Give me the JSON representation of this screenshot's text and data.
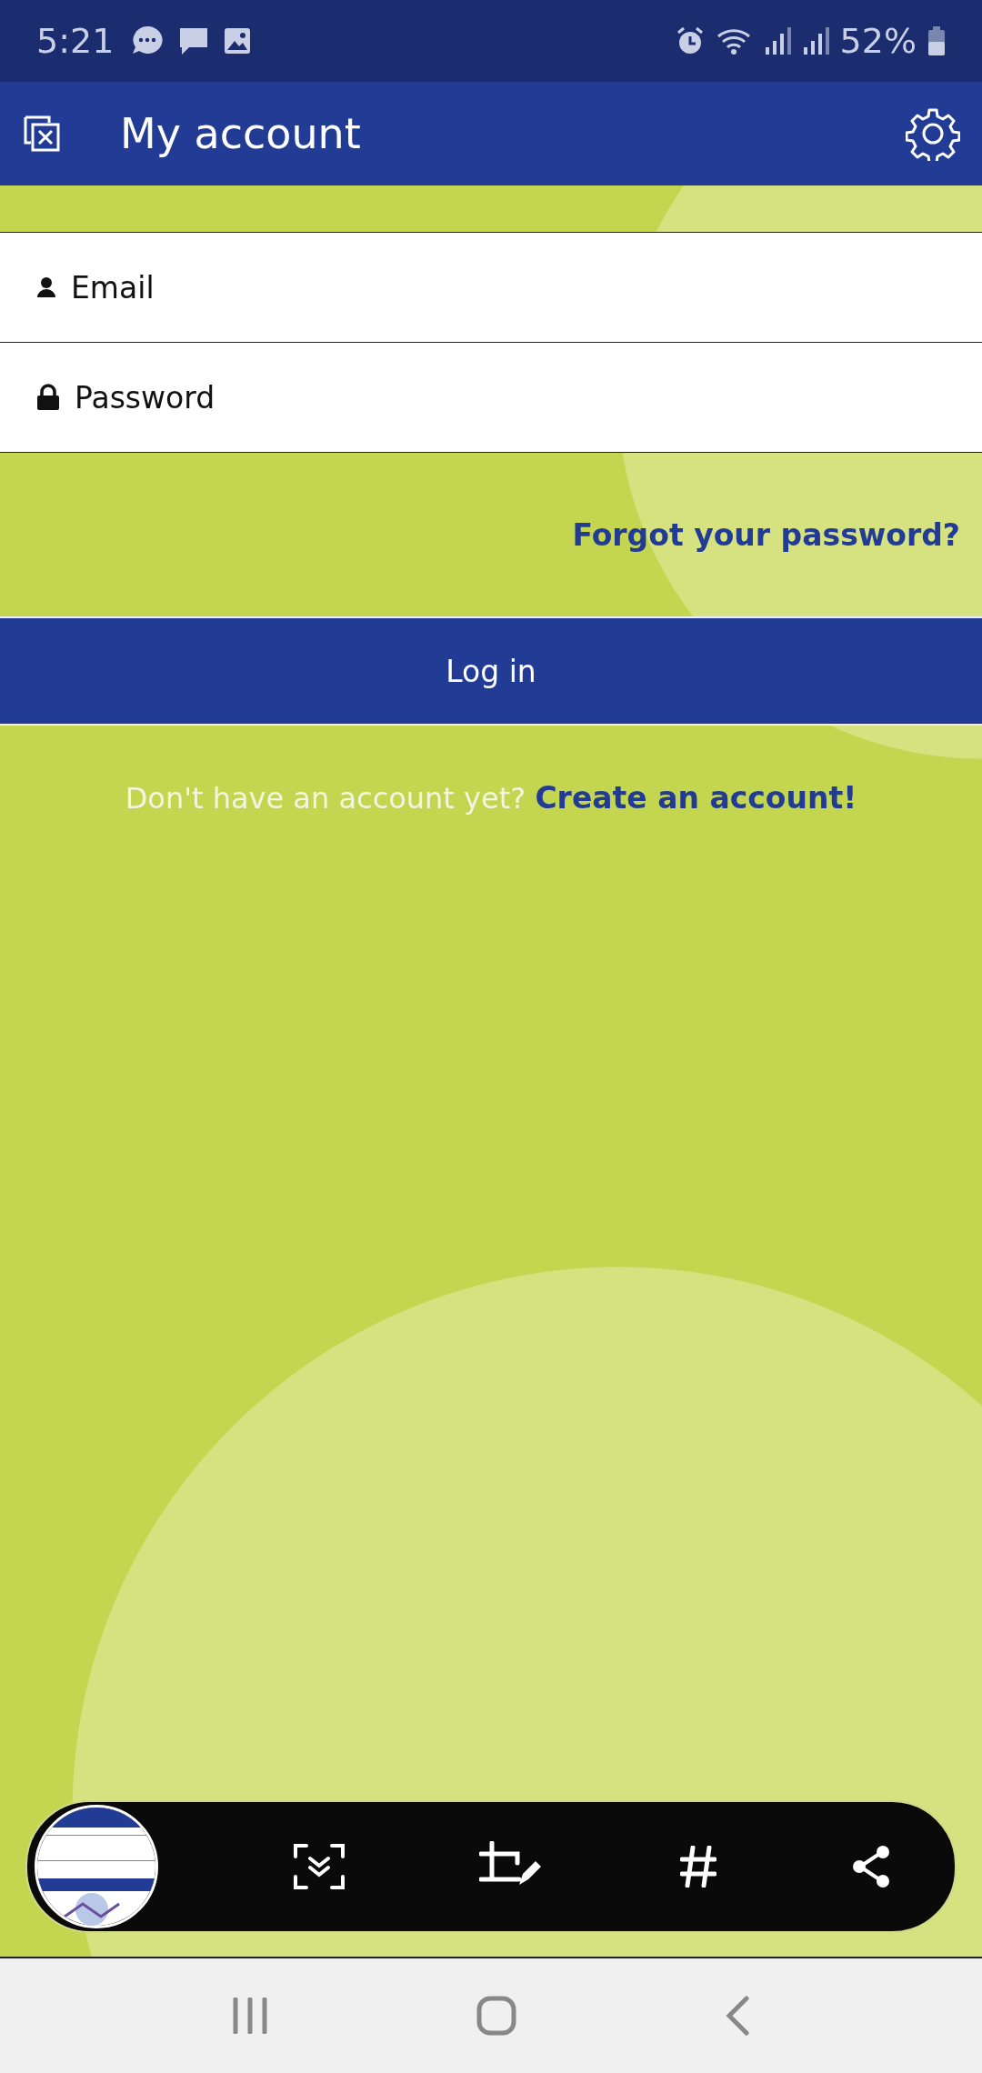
{
  "status_bar": {
    "time": "5:21",
    "battery": "52%"
  },
  "app_bar": {
    "title": "My account"
  },
  "login_form": {
    "email": {
      "placeholder": "Email"
    },
    "password": {
      "placeholder": "Password"
    },
    "forgot_link": "Forgot your password?",
    "login_button": "Log in"
  },
  "signup": {
    "prompt": "Don't have an account yet?",
    "link": "Create an account!"
  }
}
